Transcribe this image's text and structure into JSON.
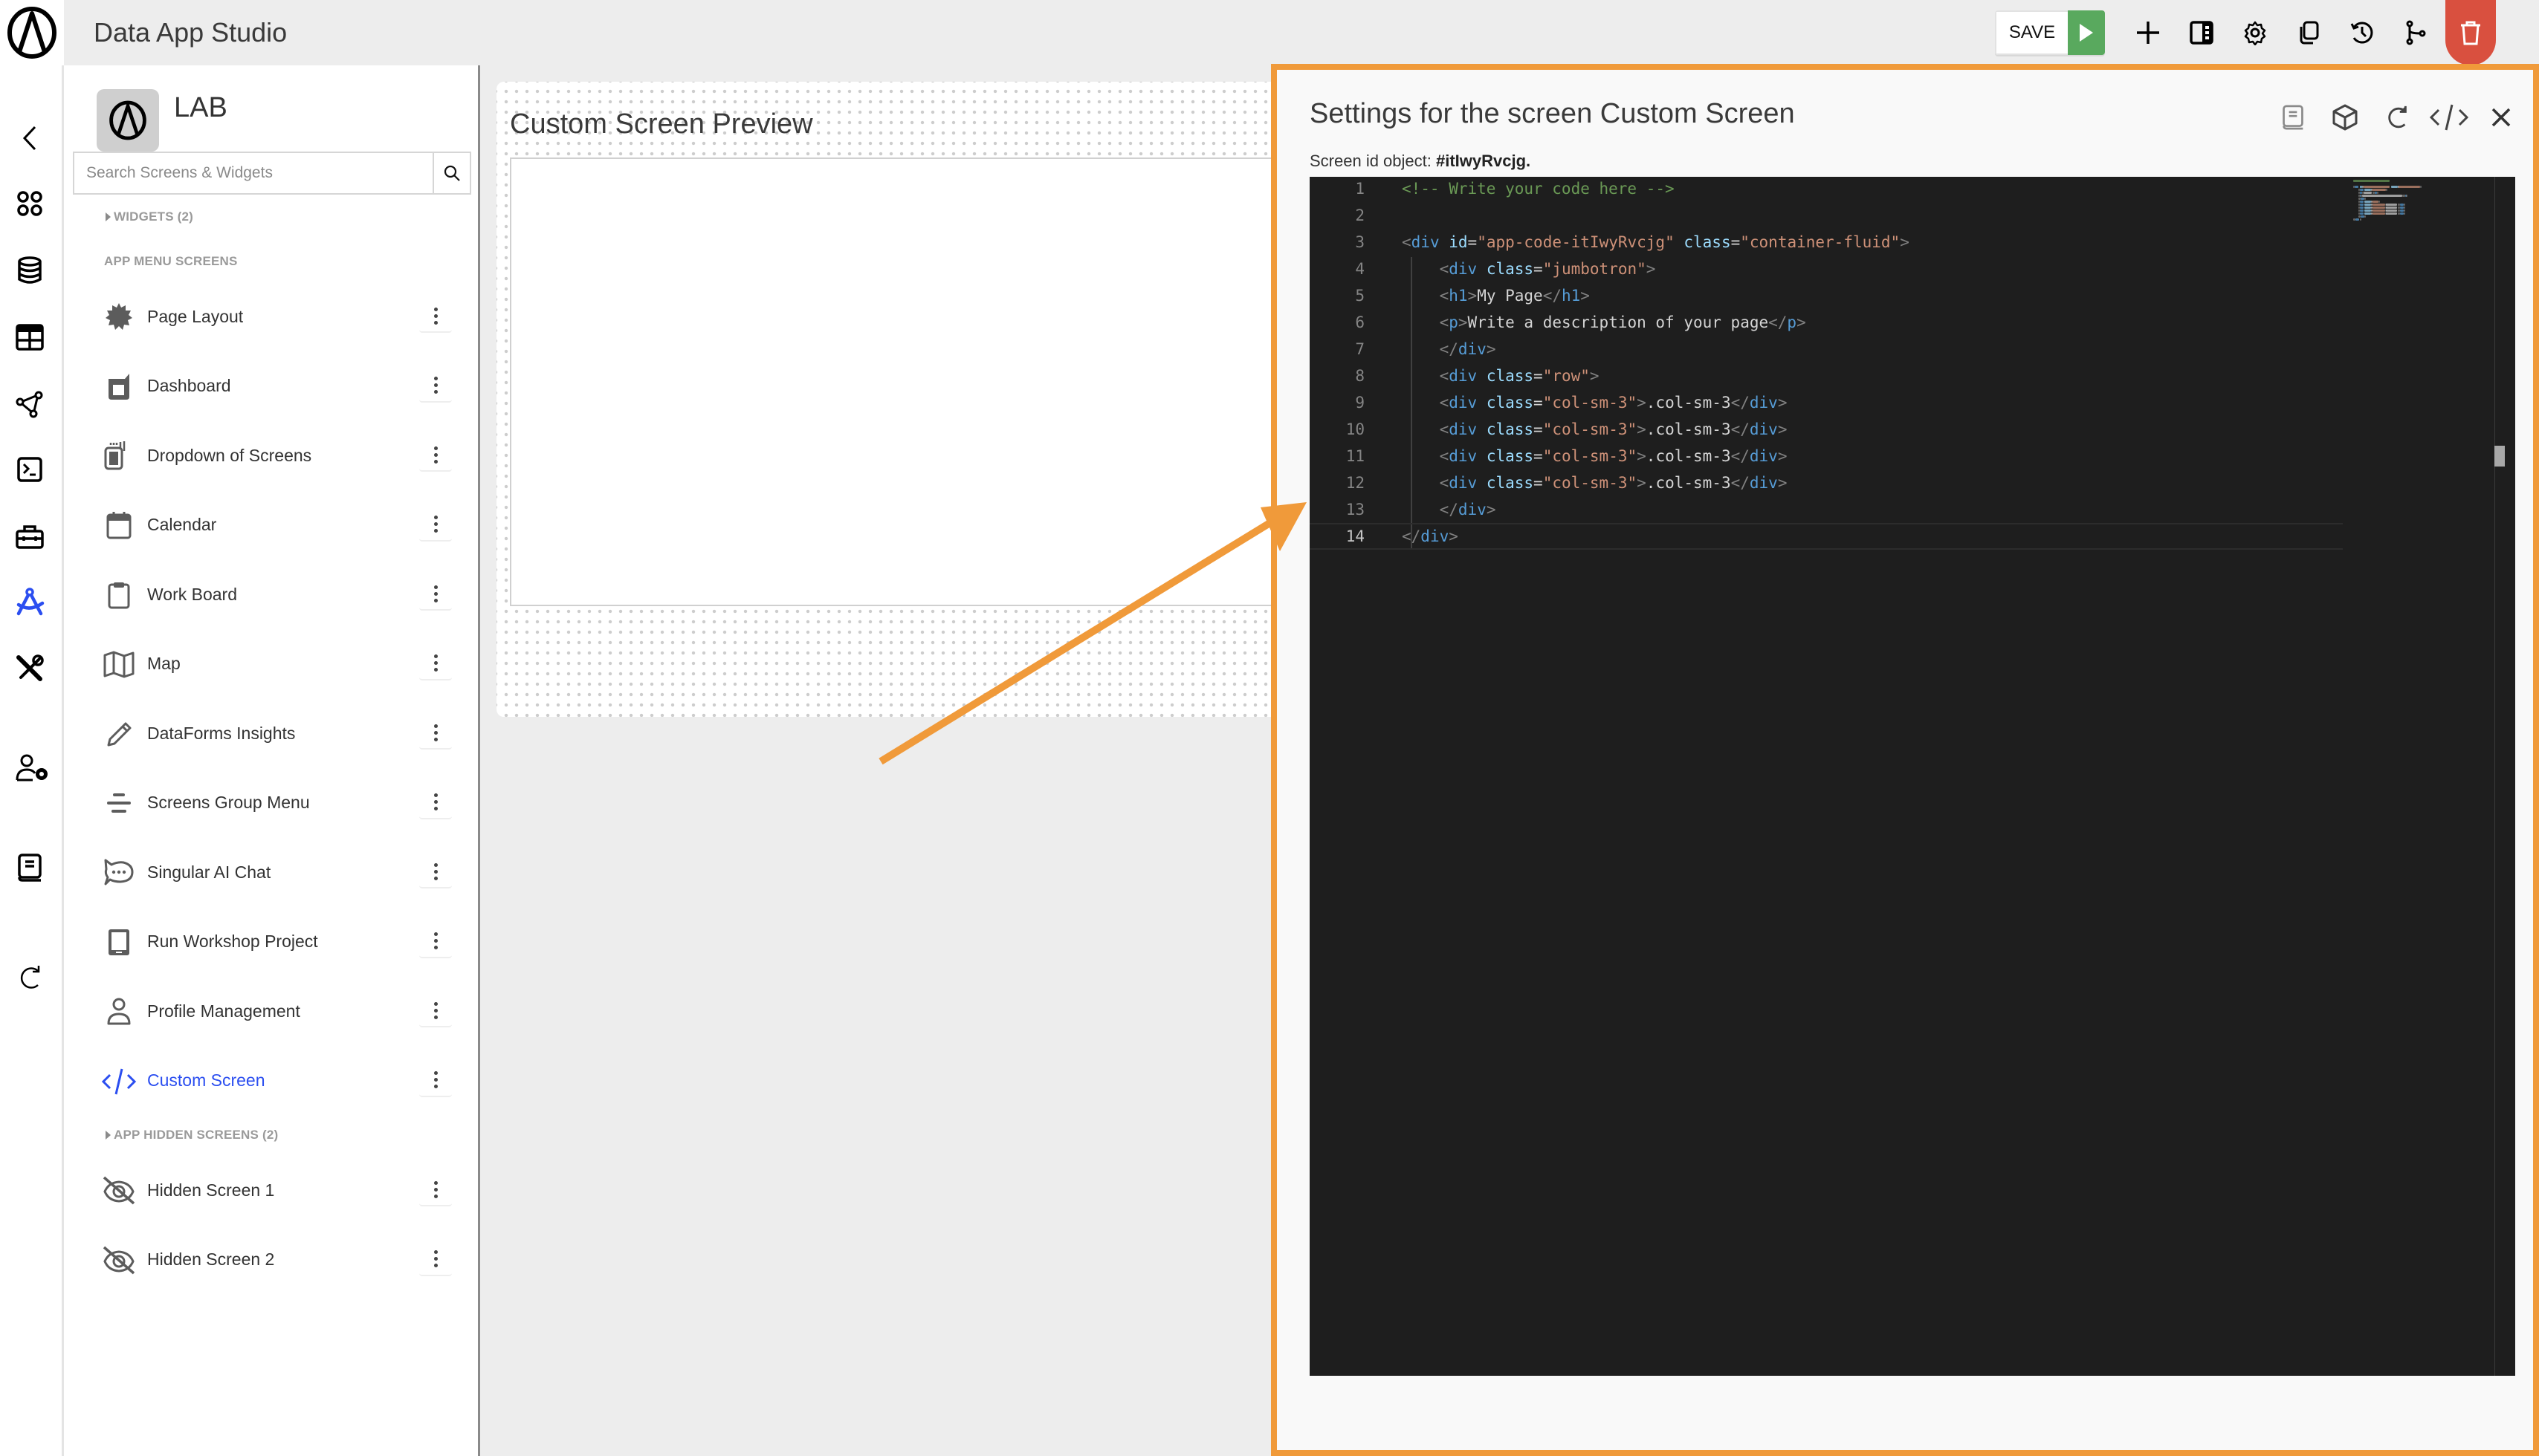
{
  "app": {
    "title": "Data App Studio",
    "logo_icon": "brand-logo-icon"
  },
  "toolbar": {
    "save_label": "SAVE",
    "run_icon": "play-icon",
    "icons": [
      "plus-icon",
      "panel-icon",
      "gear-icon",
      "copy-icon",
      "history-icon",
      "branch-icon",
      "trash-icon"
    ],
    "accent_run": "#59a95e",
    "accent_delete": "#d9503f"
  },
  "rail": {
    "icons": [
      "chevron-left-icon",
      "apps-grid-icon",
      "database-icon",
      "table-icon",
      "network-icon",
      "terminal-icon",
      "toolbox-icon",
      "design-compass-icon",
      "tools-icon",
      "user-settings-icon",
      "book-icon",
      "refresh-icon"
    ],
    "active_icon": "design-compass-icon",
    "active_color": "#2b4ef0"
  },
  "sidebar": {
    "project_title": "LAB",
    "search_placeholder": "Search Screens & Widgets",
    "search_value": "",
    "widgets_label": "WIDGETS (2)",
    "menu_screens_label": "APP MENU SCREENS",
    "hidden_screens_label": "APP HIDDEN SCREENS (2)",
    "menu_items": [
      {
        "label": "Page Layout",
        "icon": "badge-icon"
      },
      {
        "label": "Dashboard",
        "icon": "dashboard-icon"
      },
      {
        "label": "Dropdown of Screens",
        "icon": "dropdown-screens-icon"
      },
      {
        "label": "Calendar",
        "icon": "calendar-icon"
      },
      {
        "label": "Work Board",
        "icon": "clipboard-icon"
      },
      {
        "label": "Map",
        "icon": "map-icon"
      },
      {
        "label": "DataForms Insights",
        "icon": "pencil-icon"
      },
      {
        "label": "Screens Group Menu",
        "icon": "align-center-icon"
      },
      {
        "label": "Singular AI Chat",
        "icon": "chat-bubble-icon"
      },
      {
        "label": "Run Workshop Project",
        "icon": "tablet-icon"
      },
      {
        "label": "Profile Management",
        "icon": "user-icon"
      },
      {
        "label": "Custom Screen",
        "icon": "code-icon",
        "active": true
      }
    ],
    "hidden_items": [
      {
        "label": "Hidden Screen 1",
        "icon": "eye-off-icon"
      },
      {
        "label": "Hidden Screen 2",
        "icon": "eye-off-icon"
      }
    ]
  },
  "preview": {
    "title": "Custom Screen Preview"
  },
  "settings": {
    "title": "Settings for the screen Custom Screen",
    "screen_id_label": "Screen id object: ",
    "screen_id_value": "#itIwyRvcjg.",
    "action_icons": [
      "book-icon",
      "cube-icon",
      "refresh-icon",
      "code-icon",
      "close-icon"
    ],
    "border_color": "#f09a3a"
  },
  "editor": {
    "current_line": 14,
    "lines": [
      {
        "n": "1",
        "tokens": [
          [
            "comment",
            "<!-- Write your code here -->"
          ]
        ]
      },
      {
        "n": "2",
        "tokens": []
      },
      {
        "n": "3",
        "tokens": [
          [
            "punct",
            "<"
          ],
          [
            "tag",
            "div"
          ],
          [
            "text",
            " "
          ],
          [
            "attr",
            "id"
          ],
          [
            "text",
            "="
          ],
          [
            "str",
            "\"app-code-itIwyRvcjg\""
          ],
          [
            "text",
            " "
          ],
          [
            "attr",
            "class"
          ],
          [
            "text",
            "="
          ],
          [
            "str",
            "\"container-fluid\""
          ],
          [
            "punct",
            ">"
          ]
        ]
      },
      {
        "n": "4",
        "tokens": [
          [
            "text",
            "    "
          ],
          [
            "punct",
            "<"
          ],
          [
            "tag",
            "div"
          ],
          [
            "text",
            " "
          ],
          [
            "attr",
            "class"
          ],
          [
            "text",
            "="
          ],
          [
            "str",
            "\"jumbotron\""
          ],
          [
            "punct",
            ">"
          ]
        ]
      },
      {
        "n": "5",
        "tokens": [
          [
            "text",
            "    "
          ],
          [
            "punct",
            "<"
          ],
          [
            "tag",
            "h1"
          ],
          [
            "punct",
            ">"
          ],
          [
            "text",
            "My Page"
          ],
          [
            "punct",
            "</"
          ],
          [
            "tag",
            "h1"
          ],
          [
            "punct",
            ">"
          ]
        ]
      },
      {
        "n": "6",
        "tokens": [
          [
            "text",
            "    "
          ],
          [
            "punct",
            "<"
          ],
          [
            "tag",
            "p"
          ],
          [
            "punct",
            ">"
          ],
          [
            "text",
            "Write a description of your page"
          ],
          [
            "punct",
            "</"
          ],
          [
            "tag",
            "p"
          ],
          [
            "punct",
            ">"
          ]
        ]
      },
      {
        "n": "7",
        "tokens": [
          [
            "text",
            "    "
          ],
          [
            "punct",
            "</"
          ],
          [
            "tag",
            "div"
          ],
          [
            "punct",
            ">"
          ]
        ]
      },
      {
        "n": "8",
        "tokens": [
          [
            "text",
            "    "
          ],
          [
            "punct",
            "<"
          ],
          [
            "tag",
            "div"
          ],
          [
            "text",
            " "
          ],
          [
            "attr",
            "class"
          ],
          [
            "text",
            "="
          ],
          [
            "str",
            "\"row\""
          ],
          [
            "punct",
            ">"
          ]
        ]
      },
      {
        "n": "9",
        "tokens": [
          [
            "text",
            "    "
          ],
          [
            "punct",
            "<"
          ],
          [
            "tag",
            "div"
          ],
          [
            "text",
            " "
          ],
          [
            "attr",
            "class"
          ],
          [
            "text",
            "="
          ],
          [
            "str",
            "\"col-sm-3\""
          ],
          [
            "punct",
            ">"
          ],
          [
            "text",
            ".col-sm-3"
          ],
          [
            "punct",
            "</"
          ],
          [
            "tag",
            "div"
          ],
          [
            "punct",
            ">"
          ]
        ]
      },
      {
        "n": "10",
        "tokens": [
          [
            "text",
            "    "
          ],
          [
            "punct",
            "<"
          ],
          [
            "tag",
            "div"
          ],
          [
            "text",
            " "
          ],
          [
            "attr",
            "class"
          ],
          [
            "text",
            "="
          ],
          [
            "str",
            "\"col-sm-3\""
          ],
          [
            "punct",
            ">"
          ],
          [
            "text",
            ".col-sm-3"
          ],
          [
            "punct",
            "</"
          ],
          [
            "tag",
            "div"
          ],
          [
            "punct",
            ">"
          ]
        ]
      },
      {
        "n": "11",
        "tokens": [
          [
            "text",
            "    "
          ],
          [
            "punct",
            "<"
          ],
          [
            "tag",
            "div"
          ],
          [
            "text",
            " "
          ],
          [
            "attr",
            "class"
          ],
          [
            "text",
            "="
          ],
          [
            "str",
            "\"col-sm-3\""
          ],
          [
            "punct",
            ">"
          ],
          [
            "text",
            ".col-sm-3"
          ],
          [
            "punct",
            "</"
          ],
          [
            "tag",
            "div"
          ],
          [
            "punct",
            ">"
          ]
        ]
      },
      {
        "n": "12",
        "tokens": [
          [
            "text",
            "    "
          ],
          [
            "punct",
            "<"
          ],
          [
            "tag",
            "div"
          ],
          [
            "text",
            " "
          ],
          [
            "attr",
            "class"
          ],
          [
            "text",
            "="
          ],
          [
            "str",
            "\"col-sm-3\""
          ],
          [
            "punct",
            ">"
          ],
          [
            "text",
            ".col-sm-3"
          ],
          [
            "punct",
            "</"
          ],
          [
            "tag",
            "div"
          ],
          [
            "punct",
            ">"
          ]
        ]
      },
      {
        "n": "13",
        "tokens": [
          [
            "text",
            "    "
          ],
          [
            "punct",
            "</"
          ],
          [
            "tag",
            "div"
          ],
          [
            "punct",
            ">"
          ]
        ]
      },
      {
        "n": "14",
        "tokens": [
          [
            "punct",
            "</"
          ],
          [
            "tag",
            "div"
          ],
          [
            "punct",
            ">"
          ]
        ]
      }
    ]
  },
  "annotation": {
    "arrow_color": "#f09a3a",
    "arrow_icon": "annotation-arrow"
  }
}
